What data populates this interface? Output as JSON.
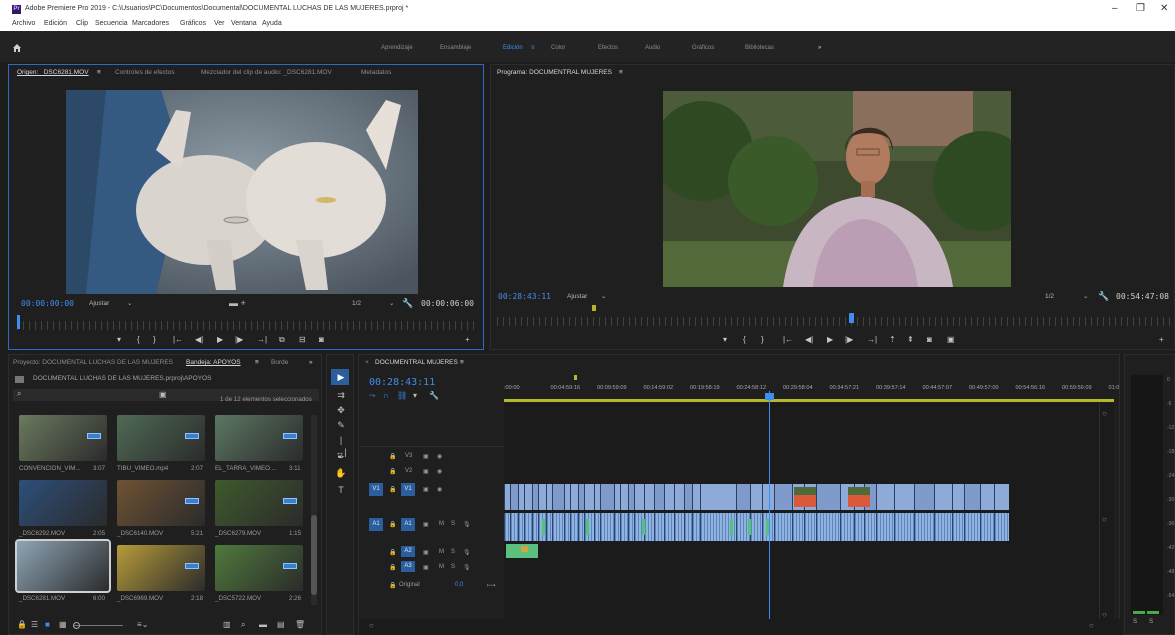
{
  "title_bar": {
    "app_icon": "Pr",
    "title": "Adobe Premiere Pro 2019 - C:\\Usuarios\\PC\\Documentos\\Documental\\DOCUMENTAL LUCHAS DE LAS MUJERES.prproj *",
    "minimize": "–",
    "maximize": "❐",
    "close": "✕"
  },
  "menu": {
    "items": [
      "Archivo",
      "Edición",
      "Clip",
      "Secuencia",
      "Marcadores",
      "Gráficos",
      "Ver",
      "Ventana",
      "Ayuda"
    ]
  },
  "workspaces": {
    "home_icon": "home-icon",
    "tabs": [
      "Aprendizaje",
      "Ensamblaje",
      "Edición",
      "Color",
      "Efectos",
      "Audio",
      "Gráficos",
      "Bibliotecas"
    ],
    "active": "Edición",
    "menu_glyph": "≡",
    "more": "»"
  },
  "source_monitor": {
    "tabs": [
      "Origen: _DSC6281.MOV",
      "Controles de efectos",
      "Mezclador del clip de audio: _DSC6281.MOV",
      "Metadatos"
    ],
    "tab_menu": "≡",
    "timecode_in": "00:00:00:00",
    "fit": "Ajustar",
    "resolution": "1/2",
    "duration": "00:00:06:00"
  },
  "program_monitor": {
    "tab": "Programa: DOCUMENTRAL MUJERES",
    "tab_menu": "≡",
    "timecode": "00:28:43:11",
    "fit": "Ajustar",
    "resolution": "1/2",
    "duration": "00:54:47:08"
  },
  "project_panel": {
    "tabs": [
      "Proyecto: DOCUMENTAL LUCHAS DE LAS MUJERES",
      "Bandeja: APOYOS",
      "Borde"
    ],
    "more": "»",
    "path": "DOCUMENTAL LUCHAS DE LAS MUJERES.prproj\\APOYOS",
    "selection_info": "1 de 12 elementos seleccionados",
    "items": [
      {
        "name": "CONVENCION_VIM...",
        "duration": "3:07",
        "color": "#6b7a5e"
      },
      {
        "name": "TIBU_VIMEO.mp4",
        "duration": "2:07",
        "color": "#4f6a55"
      },
      {
        "name": "EL_TARRA_VIMEO....",
        "duration": "3:11",
        "color": "#5b7763"
      },
      {
        "name": "_DSC6292.MOV",
        "duration": "2:05",
        "color": "#2c4f7a"
      },
      {
        "name": "_DSC6140.MOV",
        "duration": "5:21",
        "color": "#6e5234"
      },
      {
        "name": "_DSC6279.MOV",
        "duration": "1:15",
        "color": "#3e5a2c"
      },
      {
        "name": "_DSC6281.MOV",
        "duration": "6:00",
        "color": "#8ea5b6"
      },
      {
        "name": "_DSC6969.MOV",
        "duration": "2:18",
        "color": "#b69b3a"
      },
      {
        "name": "_DSC5722.MOV",
        "duration": "2:26",
        "color": "#4f7a3c"
      }
    ]
  },
  "timeline": {
    "tab": "DOCUMENTRAL MUJERES",
    "tab_close": "×",
    "tab_menu": "≡",
    "timecode": "00:28:43:11",
    "ruler_labels": [
      ":00:00",
      "00:04:59:16",
      "00:09:59:09",
      "00:14:59:02",
      "00:19:58:19",
      "00:24:58:12",
      "00:29:58:04",
      "00:34:57:21",
      "00:39:57:14",
      "00:44:57:07",
      "00:49:57:00",
      "00:54:56:16",
      "00:59:56:09",
      "01:0"
    ],
    "video_tracks": [
      "V3",
      "V2",
      "V1"
    ],
    "audio_tracks": [
      "A1",
      "A2",
      "A3"
    ],
    "source_v": "V1",
    "source_a": "A1",
    "track_m": "M",
    "track_s": "S",
    "master": "Original",
    "master_value": "0,0"
  },
  "audio_meter": {
    "labels": [
      "0",
      "-6",
      "-12",
      "-18",
      "-24",
      "-30",
      "-36",
      "-42",
      "-48",
      "-54"
    ],
    "solo_buttons": [
      "S",
      "S"
    ]
  }
}
